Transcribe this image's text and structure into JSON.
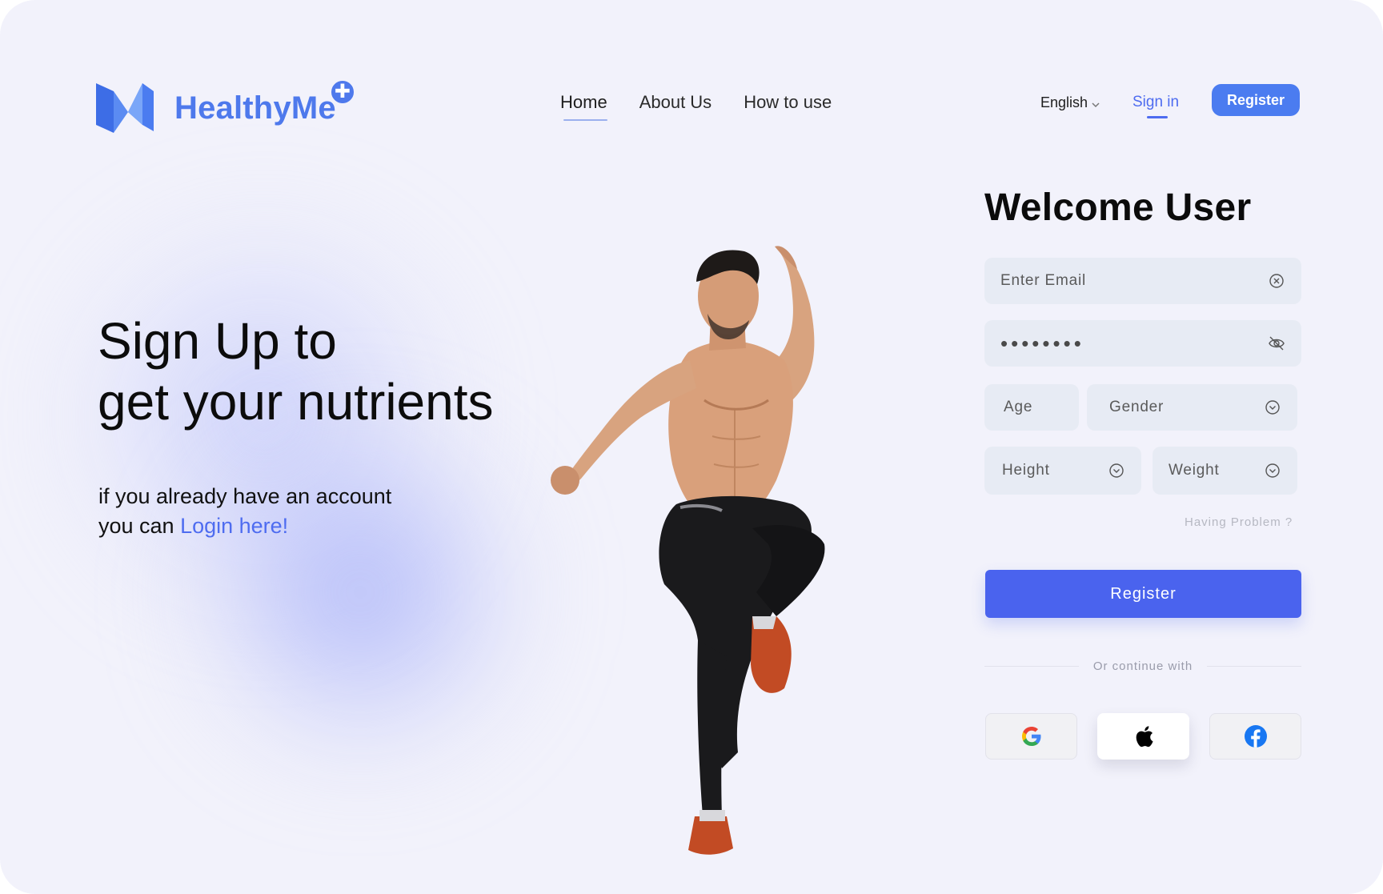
{
  "header": {
    "brand": "HealthyMe",
    "brand_badge": "✚",
    "nav": [
      {
        "label": "Home",
        "active": true
      },
      {
        "label": "About Us",
        "active": false
      },
      {
        "label": "How to use",
        "active": false
      }
    ],
    "language": "English",
    "signin_label": "Sign in",
    "register_label": "Register"
  },
  "hero": {
    "title_line1": "Sign Up to",
    "title_line2": "get your nutrients",
    "sub_line1": "if you already have an account",
    "sub_line2_prefix": "you can ",
    "login_link": "Login here!"
  },
  "form": {
    "title": "Welcome User",
    "email_placeholder": "Enter Email",
    "password_value": "••••••••",
    "age_placeholder": "Age",
    "gender_placeholder": "Gender",
    "height_placeholder": "Height",
    "weight_placeholder": "Weight",
    "problem_link": "Having Problem ?",
    "register_label": "Register",
    "divider_label": "Or continue with",
    "social": [
      "google-icon",
      "apple-icon",
      "facebook-icon"
    ]
  },
  "colors": {
    "accent": "#4a63ee",
    "brand": "#4e79ec",
    "background": "#f2f2fb"
  }
}
